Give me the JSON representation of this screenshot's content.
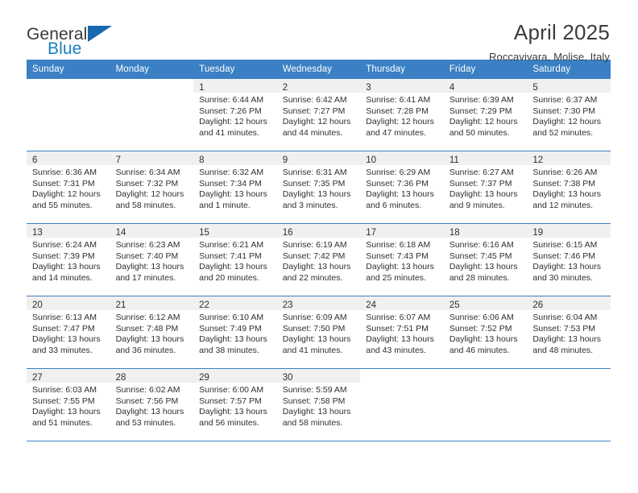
{
  "brand": {
    "name_top": "General",
    "name_bottom": "Blue",
    "triangle_color": "#1768ad",
    "blue_color": "#1b7ec4"
  },
  "header": {
    "title": "April 2025",
    "subtitle": "Roccavivara, Molise, Italy"
  },
  "theme": {
    "header_bg": "#3b80c4",
    "row_band_bg": "#f0f0f0",
    "text": "#2f2f2f"
  },
  "weekdays": [
    "Sunday",
    "Monday",
    "Tuesday",
    "Wednesday",
    "Thursday",
    "Friday",
    "Saturday"
  ],
  "weeks": [
    [
      {
        "day": "",
        "sunrise": "",
        "sunset": "",
        "daylight_1": "",
        "daylight_2": ""
      },
      {
        "day": "",
        "sunrise": "",
        "sunset": "",
        "daylight_1": "",
        "daylight_2": ""
      },
      {
        "day": "1",
        "sunrise": "Sunrise: 6:44 AM",
        "sunset": "Sunset: 7:26 PM",
        "daylight_1": "Daylight: 12 hours",
        "daylight_2": "and 41 minutes."
      },
      {
        "day": "2",
        "sunrise": "Sunrise: 6:42 AM",
        "sunset": "Sunset: 7:27 PM",
        "daylight_1": "Daylight: 12 hours",
        "daylight_2": "and 44 minutes."
      },
      {
        "day": "3",
        "sunrise": "Sunrise: 6:41 AM",
        "sunset": "Sunset: 7:28 PM",
        "daylight_1": "Daylight: 12 hours",
        "daylight_2": "and 47 minutes."
      },
      {
        "day": "4",
        "sunrise": "Sunrise: 6:39 AM",
        "sunset": "Sunset: 7:29 PM",
        "daylight_1": "Daylight: 12 hours",
        "daylight_2": "and 50 minutes."
      },
      {
        "day": "5",
        "sunrise": "Sunrise: 6:37 AM",
        "sunset": "Sunset: 7:30 PM",
        "daylight_1": "Daylight: 12 hours",
        "daylight_2": "and 52 minutes."
      }
    ],
    [
      {
        "day": "6",
        "sunrise": "Sunrise: 6:36 AM",
        "sunset": "Sunset: 7:31 PM",
        "daylight_1": "Daylight: 12 hours",
        "daylight_2": "and 55 minutes."
      },
      {
        "day": "7",
        "sunrise": "Sunrise: 6:34 AM",
        "sunset": "Sunset: 7:32 PM",
        "daylight_1": "Daylight: 12 hours",
        "daylight_2": "and 58 minutes."
      },
      {
        "day": "8",
        "sunrise": "Sunrise: 6:32 AM",
        "sunset": "Sunset: 7:34 PM",
        "daylight_1": "Daylight: 13 hours",
        "daylight_2": "and 1 minute."
      },
      {
        "day": "9",
        "sunrise": "Sunrise: 6:31 AM",
        "sunset": "Sunset: 7:35 PM",
        "daylight_1": "Daylight: 13 hours",
        "daylight_2": "and 3 minutes."
      },
      {
        "day": "10",
        "sunrise": "Sunrise: 6:29 AM",
        "sunset": "Sunset: 7:36 PM",
        "daylight_1": "Daylight: 13 hours",
        "daylight_2": "and 6 minutes."
      },
      {
        "day": "11",
        "sunrise": "Sunrise: 6:27 AM",
        "sunset": "Sunset: 7:37 PM",
        "daylight_1": "Daylight: 13 hours",
        "daylight_2": "and 9 minutes."
      },
      {
        "day": "12",
        "sunrise": "Sunrise: 6:26 AM",
        "sunset": "Sunset: 7:38 PM",
        "daylight_1": "Daylight: 13 hours",
        "daylight_2": "and 12 minutes."
      }
    ],
    [
      {
        "day": "13",
        "sunrise": "Sunrise: 6:24 AM",
        "sunset": "Sunset: 7:39 PM",
        "daylight_1": "Daylight: 13 hours",
        "daylight_2": "and 14 minutes."
      },
      {
        "day": "14",
        "sunrise": "Sunrise: 6:23 AM",
        "sunset": "Sunset: 7:40 PM",
        "daylight_1": "Daylight: 13 hours",
        "daylight_2": "and 17 minutes."
      },
      {
        "day": "15",
        "sunrise": "Sunrise: 6:21 AM",
        "sunset": "Sunset: 7:41 PM",
        "daylight_1": "Daylight: 13 hours",
        "daylight_2": "and 20 minutes."
      },
      {
        "day": "16",
        "sunrise": "Sunrise: 6:19 AM",
        "sunset": "Sunset: 7:42 PM",
        "daylight_1": "Daylight: 13 hours",
        "daylight_2": "and 22 minutes."
      },
      {
        "day": "17",
        "sunrise": "Sunrise: 6:18 AM",
        "sunset": "Sunset: 7:43 PM",
        "daylight_1": "Daylight: 13 hours",
        "daylight_2": "and 25 minutes."
      },
      {
        "day": "18",
        "sunrise": "Sunrise: 6:16 AM",
        "sunset": "Sunset: 7:45 PM",
        "daylight_1": "Daylight: 13 hours",
        "daylight_2": "and 28 minutes."
      },
      {
        "day": "19",
        "sunrise": "Sunrise: 6:15 AM",
        "sunset": "Sunset: 7:46 PM",
        "daylight_1": "Daylight: 13 hours",
        "daylight_2": "and 30 minutes."
      }
    ],
    [
      {
        "day": "20",
        "sunrise": "Sunrise: 6:13 AM",
        "sunset": "Sunset: 7:47 PM",
        "daylight_1": "Daylight: 13 hours",
        "daylight_2": "and 33 minutes."
      },
      {
        "day": "21",
        "sunrise": "Sunrise: 6:12 AM",
        "sunset": "Sunset: 7:48 PM",
        "daylight_1": "Daylight: 13 hours",
        "daylight_2": "and 36 minutes."
      },
      {
        "day": "22",
        "sunrise": "Sunrise: 6:10 AM",
        "sunset": "Sunset: 7:49 PM",
        "daylight_1": "Daylight: 13 hours",
        "daylight_2": "and 38 minutes."
      },
      {
        "day": "23",
        "sunrise": "Sunrise: 6:09 AM",
        "sunset": "Sunset: 7:50 PM",
        "daylight_1": "Daylight: 13 hours",
        "daylight_2": "and 41 minutes."
      },
      {
        "day": "24",
        "sunrise": "Sunrise: 6:07 AM",
        "sunset": "Sunset: 7:51 PM",
        "daylight_1": "Daylight: 13 hours",
        "daylight_2": "and 43 minutes."
      },
      {
        "day": "25",
        "sunrise": "Sunrise: 6:06 AM",
        "sunset": "Sunset: 7:52 PM",
        "daylight_1": "Daylight: 13 hours",
        "daylight_2": "and 46 minutes."
      },
      {
        "day": "26",
        "sunrise": "Sunrise: 6:04 AM",
        "sunset": "Sunset: 7:53 PM",
        "daylight_1": "Daylight: 13 hours",
        "daylight_2": "and 48 minutes."
      }
    ],
    [
      {
        "day": "27",
        "sunrise": "Sunrise: 6:03 AM",
        "sunset": "Sunset: 7:55 PM",
        "daylight_1": "Daylight: 13 hours",
        "daylight_2": "and 51 minutes."
      },
      {
        "day": "28",
        "sunrise": "Sunrise: 6:02 AM",
        "sunset": "Sunset: 7:56 PM",
        "daylight_1": "Daylight: 13 hours",
        "daylight_2": "and 53 minutes."
      },
      {
        "day": "29",
        "sunrise": "Sunrise: 6:00 AM",
        "sunset": "Sunset: 7:57 PM",
        "daylight_1": "Daylight: 13 hours",
        "daylight_2": "and 56 minutes."
      },
      {
        "day": "30",
        "sunrise": "Sunrise: 5:59 AM",
        "sunset": "Sunset: 7:58 PM",
        "daylight_1": "Daylight: 13 hours",
        "daylight_2": "and 58 minutes."
      },
      {
        "day": "",
        "sunrise": "",
        "sunset": "",
        "daylight_1": "",
        "daylight_2": ""
      },
      {
        "day": "",
        "sunrise": "",
        "sunset": "",
        "daylight_1": "",
        "daylight_2": ""
      },
      {
        "day": "",
        "sunrise": "",
        "sunset": "",
        "daylight_1": "",
        "daylight_2": ""
      }
    ]
  ]
}
